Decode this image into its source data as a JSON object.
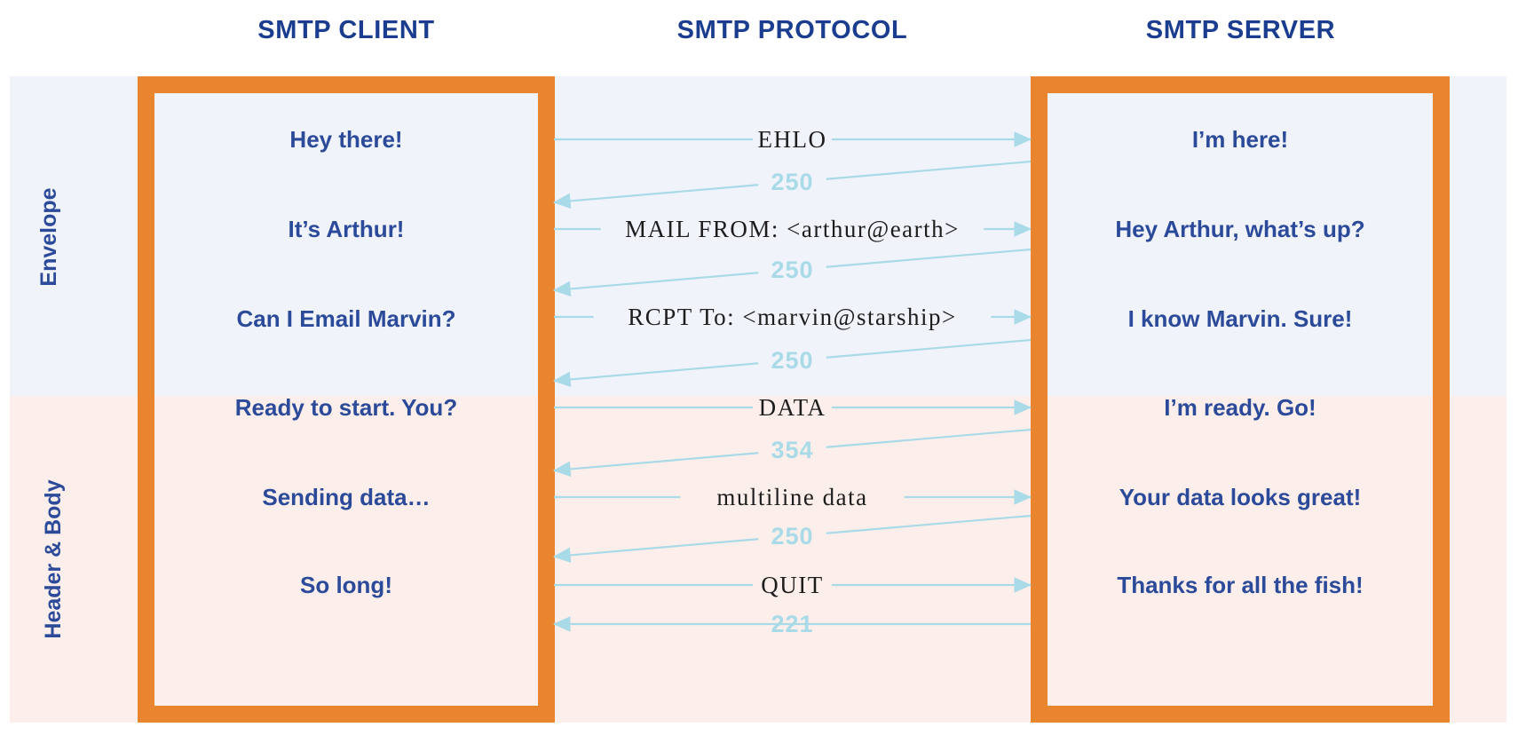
{
  "headers": {
    "client": "SMTP CLIENT",
    "protocol": "SMTP PROTOCOL",
    "server": "SMTP SERVER"
  },
  "sections": [
    {
      "id": "envelope",
      "label": "Envelope",
      "background": "#f0f3f9"
    },
    {
      "id": "header-body",
      "label": "Header & Body",
      "background": "#fcefeb"
    }
  ],
  "colors": {
    "frame_orange": "#e9852f",
    "navy_text": "#2c4a9a",
    "header_navy": "#1b3d8f",
    "wire_blue": "#a9dae8",
    "command_black": "#1d1d1d",
    "envelope_band": "#f0f3f9",
    "headerbody_band": "#fcefeb"
  },
  "client_messages": [
    "Hey there!",
    "It’s Arthur!",
    "Can I Email Marvin?",
    "Ready to start. You?",
    "Sending data…",
    "So long!"
  ],
  "server_messages": [
    "I’m here!",
    "Hey Arthur, what’s up?",
    "I know Marvin. Sure!",
    "I’m ready. Go!",
    "Your data looks great!",
    "Thanks for all the fish!"
  ],
  "exchanges": [
    {
      "label": "EHLO",
      "kind": "command",
      "direction": "client-to-server"
    },
    {
      "label": "250",
      "kind": "reply",
      "direction": "server-to-client"
    },
    {
      "label": "MAIL FROM: <arthur@earth>",
      "kind": "command",
      "direction": "client-to-server"
    },
    {
      "label": "250",
      "kind": "reply",
      "direction": "server-to-client"
    },
    {
      "label": "RCPT To: <marvin@starship>",
      "kind": "command",
      "direction": "client-to-server"
    },
    {
      "label": "250",
      "kind": "reply",
      "direction": "server-to-client"
    },
    {
      "label": "DATA",
      "kind": "command",
      "direction": "client-to-server"
    },
    {
      "label": "354",
      "kind": "reply",
      "direction": "server-to-client"
    },
    {
      "label": "multiline data",
      "kind": "command",
      "direction": "client-to-server"
    },
    {
      "label": "250",
      "kind": "reply",
      "direction": "server-to-client"
    },
    {
      "label": "QUIT",
      "kind": "command",
      "direction": "client-to-server"
    },
    {
      "label": "221",
      "kind": "reply",
      "direction": "server-to-client"
    }
  ]
}
